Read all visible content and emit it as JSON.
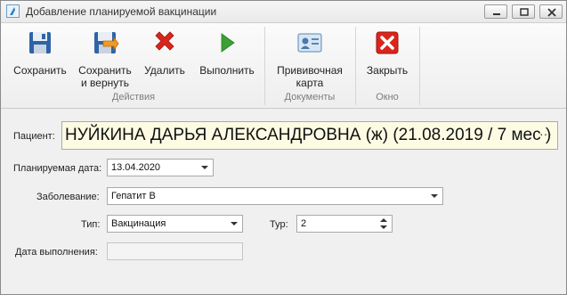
{
  "window": {
    "title": "Добавление планируемой вакцинации"
  },
  "ribbon": {
    "buttons": [
      {
        "label": "Сохранить",
        "icon": "save-icon"
      },
      {
        "label": "Сохранить",
        "label2": "и вернуть",
        "icon": "save-and-return-icon"
      },
      {
        "label": "Удалить",
        "icon": "delete-icon"
      },
      {
        "label": "Выполнить",
        "icon": "play-icon"
      },
      {
        "label": "Прививочная",
        "label2": "карта",
        "icon": "vaccination-card-icon"
      },
      {
        "label": "Закрыть",
        "icon": "close-icon"
      }
    ],
    "groups": [
      "Действия",
      "Документы",
      "Окно"
    ]
  },
  "form": {
    "patient_label": "Пациент:",
    "patient_value": "НУЙКИНА ДАРЬЯ АЛЕКСАНДРОВНА (ж) (21.08.2019 / 7 мес )",
    "patient_button": "···",
    "planned_date_label": "Планируемая дата:",
    "planned_date_value": "13.04.2020",
    "disease_label": "Заболевание:",
    "disease_value": "Гепатит В",
    "type_label": "Тип:",
    "type_value": "Вакцинация",
    "tour_label": "Тур:",
    "tour_value": "2",
    "done_date_label": "Дата выполнения:",
    "done_date_value": ""
  },
  "colors": {
    "patient_bg": "#fdfbe3",
    "delete_red": "#d9261c",
    "play_green": "#3aa235"
  }
}
